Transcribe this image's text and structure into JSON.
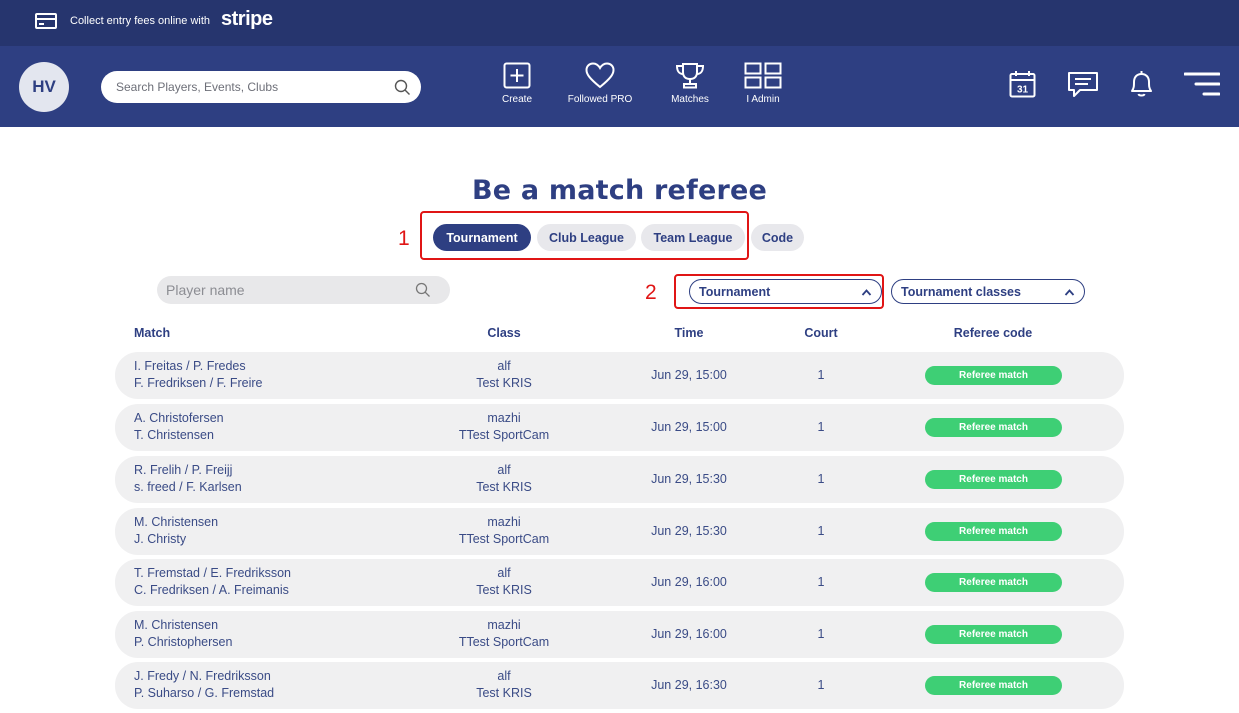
{
  "banner": {
    "text": "Collect entry fees online with",
    "brand": "stripe"
  },
  "user": {
    "initials": "HV"
  },
  "search": {
    "placeholder": "Search Players, Events, Clubs"
  },
  "nav": {
    "create": "Create",
    "followed": "Followed PRO",
    "matches": "Matches",
    "admin": "I Admin",
    "calendar_day": "31"
  },
  "page": {
    "title": "Be a match referee"
  },
  "tabs": [
    "Tournament",
    "Club League",
    "Team League",
    "Code"
  ],
  "annotations": {
    "one": "1",
    "two": "2"
  },
  "filters": {
    "player_placeholder": "Player name",
    "tournament": "Tournament",
    "classes": "Tournament classes"
  },
  "columns": {
    "match": "Match",
    "class": "Class",
    "time": "Time",
    "court": "Court",
    "code": "Referee code"
  },
  "rows": [
    {
      "p1": "I. Freitas / P. Fredes",
      "p2": "F. Fredriksen / F. Freire",
      "class1": "alf",
      "class2": "Test KRIS",
      "time": "Jun 29, 15:00",
      "court": "1",
      "button": "Referee match"
    },
    {
      "p1": "A. Christofersen",
      "p2": "T. Christensen",
      "class1": "mazhi",
      "class2": "TTest SportCam",
      "time": "Jun 29, 15:00",
      "court": "1",
      "button": "Referee match"
    },
    {
      "p1": "R. Frelih / P. Freijj",
      "p2": "s. freed / F. Karlsen",
      "class1": "alf",
      "class2": "Test KRIS",
      "time": "Jun 29, 15:30",
      "court": "1",
      "button": "Referee match"
    },
    {
      "p1": "M. Christensen",
      "p2": "J. Christy",
      "class1": "mazhi",
      "class2": "TTest SportCam",
      "time": "Jun 29, 15:30",
      "court": "1",
      "button": "Referee match"
    },
    {
      "p1": "T. Fremstad / E. Fredriksson",
      "p2": "C. Fredriksen / A. Freimanis",
      "class1": "alf",
      "class2": "Test KRIS",
      "time": "Jun 29, 16:00",
      "court": "1",
      "button": "Referee match"
    },
    {
      "p1": "M. Christensen",
      "p2": "P. Christophersen",
      "class1": "mazhi",
      "class2": "TTest SportCam",
      "time": "Jun 29, 16:00",
      "court": "1",
      "button": "Referee match"
    },
    {
      "p1": "J. Fredy / N. Fredriksson",
      "p2": "P. Suharso / G. Fremstad",
      "class1": "alf",
      "class2": "Test KRIS",
      "time": "Jun 29, 16:30",
      "court": "1",
      "button": "Referee match"
    }
  ]
}
